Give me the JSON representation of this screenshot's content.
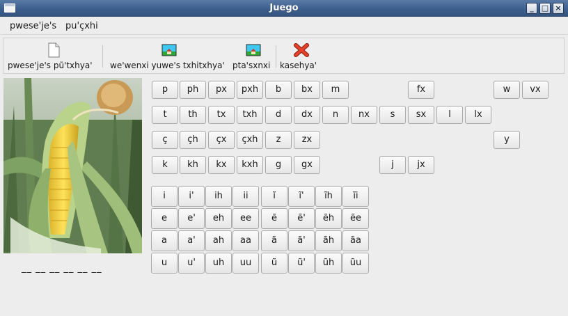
{
  "window": {
    "title": "Juego"
  },
  "menu": [
    {
      "label": "pwese'je's"
    },
    {
      "label": "pu'çxhi"
    }
  ],
  "toolbar": {
    "new_label": "pwese'je's pũ'txhya'",
    "image1_label": "we'wenxi yuwe's txhitxhya'",
    "image2_label": "pta'sxnxi",
    "exit_label": "kasehya'"
  },
  "picture": {
    "icon": "corn-photo"
  },
  "answer_blanks": "__ __ __ __ __ __",
  "consonants": [
    [
      "p",
      "ph",
      "px",
      "pxh",
      "b",
      "bx",
      "m",
      "fx",
      "w",
      "vx"
    ],
    [
      "t",
      "th",
      "tx",
      "txh",
      "d",
      "dx",
      "n",
      "nx",
      "s",
      "sx",
      "l",
      "lx"
    ],
    [
      "ç",
      "çh",
      "çx",
      "çxh",
      "z",
      "zx",
      "y"
    ],
    [
      "k",
      "kh",
      "kx",
      "kxh",
      "g",
      "gx",
      "j",
      "jx"
    ]
  ],
  "vowels": [
    [
      "i",
      "i'",
      "ih",
      "ii",
      "ĩ",
      "ĩ'",
      "ĩh",
      "ĩi"
    ],
    [
      "e",
      "e'",
      "eh",
      "ee",
      "ẽ",
      "ẽ'",
      "ẽh",
      "ẽe"
    ],
    [
      "a",
      "a'",
      "ah",
      "aa",
      "ã",
      "ã'",
      "ãh",
      "ãa"
    ],
    [
      "u",
      "u'",
      "uh",
      "uu",
      "ũ",
      "ũ'",
      "ũh",
      "ũu"
    ]
  ]
}
